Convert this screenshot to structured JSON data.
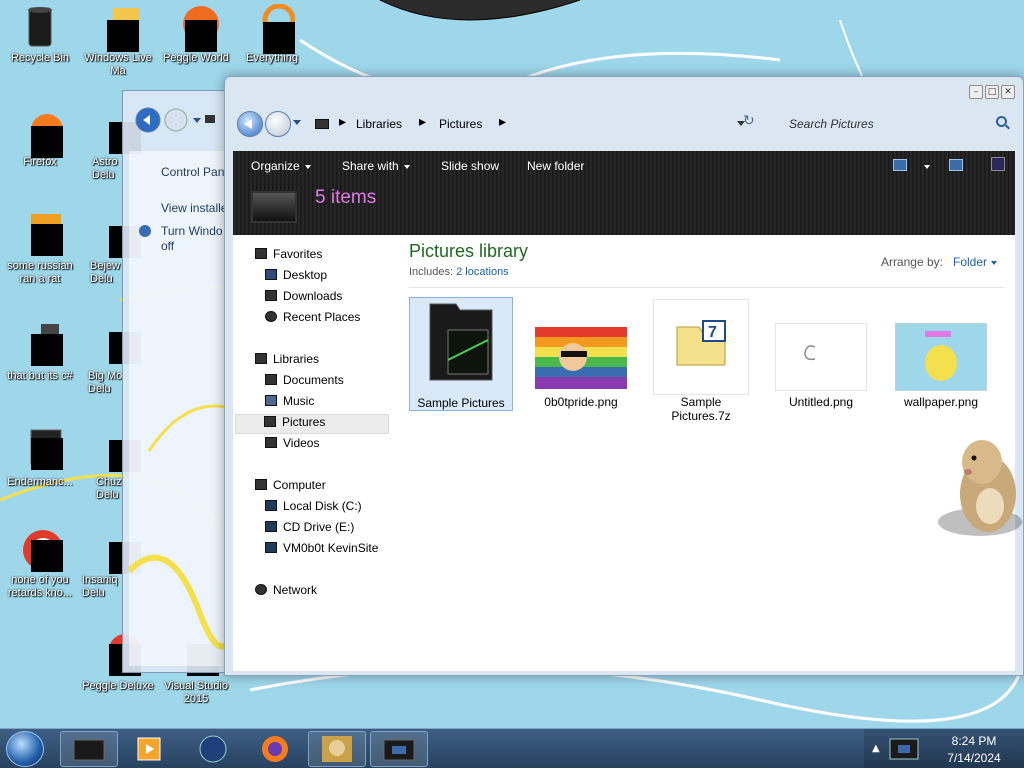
{
  "desktop": {
    "icons": [
      {
        "label": "Recycle Bin",
        "icon": "recycle-bin-icon"
      },
      {
        "label": "Windows Live Ma",
        "icon": "windows-live-icon"
      },
      {
        "label": "Peggle World",
        "icon": "peggle-world-icon"
      },
      {
        "label": "Everything",
        "icon": "everything-icon"
      },
      {
        "label": "Firefox",
        "icon": "firefox-icon"
      },
      {
        "label": "Astro Delu",
        "icon": "astro-icon"
      },
      {
        "label": "some russian ran a rat",
        "icon": "russian-icon"
      },
      {
        "label": "Bejew Delu",
        "icon": "bejeweled-icon"
      },
      {
        "label": "that but its c#",
        "icon": "shortcut-icon"
      },
      {
        "label": "Big Mo Delu",
        "icon": "big-money-icon"
      },
      {
        "label": "Endermanc...",
        "icon": "endermanch-icon"
      },
      {
        "label": "Chuz Delu",
        "icon": "chuzzle-icon"
      },
      {
        "label": "none of you retards kno...",
        "icon": "app-icon"
      },
      {
        "label": "Insaniq Delu",
        "icon": "insaniquarium-icon"
      },
      {
        "label": "Peggle Deluxe",
        "icon": "peggle-deluxe-icon"
      },
      {
        "label": "Visual Studio 2015",
        "icon": "visual-studio-icon"
      }
    ]
  },
  "control_panel_window": {
    "links": [
      "Control Pan",
      "View installe",
      "Turn Windo",
      "off"
    ]
  },
  "explorer": {
    "address": {
      "crumbs": [
        "Libraries",
        "Pictures"
      ],
      "separator": "▸"
    },
    "search_placeholder": "Search Pictures",
    "toolbar": {
      "organize": "Organize",
      "share_with": "Share with",
      "slide_show": "Slide show",
      "new_folder": "New folder"
    },
    "item_count": "5 items",
    "nav": {
      "favorites": "Favorites",
      "desktop": "Desktop",
      "downloads": "Downloads",
      "recent_places": "Recent Places",
      "libraries": "Libraries",
      "documents": "Documents",
      "music": "Music",
      "pictures": "Pictures",
      "videos": "Videos",
      "computer": "Computer",
      "local_disk": "Local Disk (C:)",
      "cd_drive": "CD Drive (E:)",
      "vm_share": "VM0b0t KevinSite",
      "network": "Network"
    },
    "library": {
      "title": "Pictures library",
      "includes_label": "Includes:",
      "includes_link": "2 locations",
      "arrange_label": "Arrange by:",
      "arrange_value": "Folder"
    },
    "files": [
      {
        "name": "Sample Pictures",
        "type": "folder"
      },
      {
        "name": "0b0tpride.png",
        "type": "image"
      },
      {
        "name": "Sample Pictures.7z",
        "type": "archive"
      },
      {
        "name": "Untitled.png",
        "type": "image"
      },
      {
        "name": "wallpaper.png",
        "type": "image"
      }
    ]
  },
  "taskbar": {
    "time": "8:24 PM",
    "date": "7/14/2024"
  },
  "colors": {
    "wallpaper": "#9fd7ea",
    "library_title": "#1e6a1e",
    "item_count": "#e279e5",
    "link": "#1b5fad"
  }
}
